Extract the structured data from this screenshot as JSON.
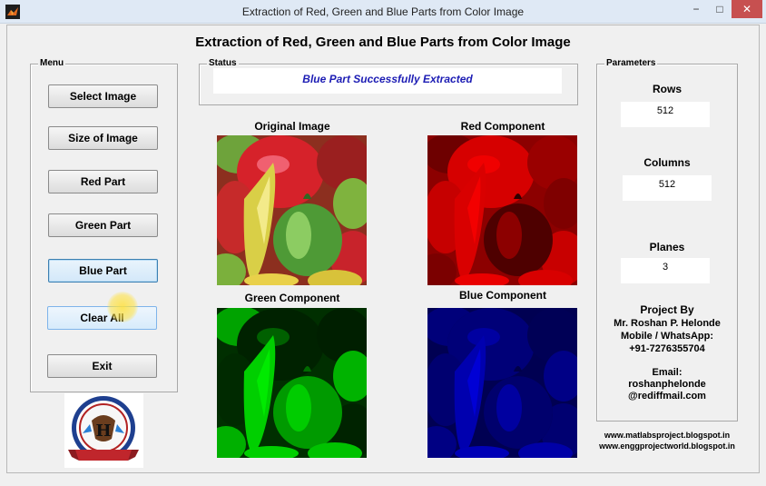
{
  "window": {
    "title": "Extraction of Red, Green and Blue Parts from Color Image",
    "minimize": "−",
    "maximize": "□",
    "close": "✕"
  },
  "main_title": "Extraction of Red, Green and Blue Parts from Color Image",
  "menu": {
    "title": "Menu",
    "buttons": {
      "select_image": "Select Image",
      "size_of_image": "Size of Image",
      "red_part": "Red Part",
      "green_part": "Green Part",
      "blue_part": "Blue Part",
      "clear_all": "Clear All",
      "exit": "Exit"
    }
  },
  "status": {
    "title": "Status",
    "message": "Blue Part Successfully Extracted",
    "color": "#1c1cb4"
  },
  "images": {
    "original": "Original Image",
    "red": "Red Component",
    "green": "Green Component",
    "blue": "Blue Component"
  },
  "parameters": {
    "title": "Parameters",
    "rows_label": "Rows",
    "rows_value": "512",
    "columns_label": "Columns",
    "columns_value": "512",
    "planes_label": "Planes",
    "planes_value": "3"
  },
  "credits": {
    "project_by": "Project By",
    "name": "Mr. Roshan P. Helonde",
    "mobile_label": "Mobile / WhatsApp:",
    "phone": "+91-7276355704",
    "email_label": "Email:",
    "email_user": "roshanphelonde",
    "email_domain": "@rediffmail.com",
    "url1": "www.matlabsproject.blogspot.in",
    "url2": "www.enggprojectworld.blogspot.in"
  },
  "icons": {
    "app": "matlab-icon",
    "logo": "project-logo"
  }
}
